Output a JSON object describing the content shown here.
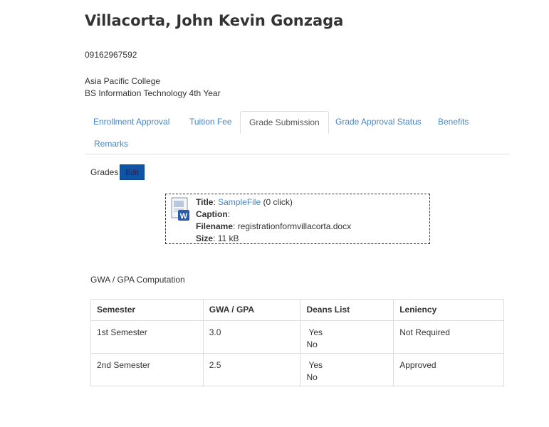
{
  "profile": {
    "name": "Villacorta, John Kevin Gonzaga",
    "phone": "09162967592",
    "school": "Asia Pacific College",
    "program": "BS Information Technology 4th Year"
  },
  "tabs": [
    {
      "label": "Enrollment Approval",
      "active": false
    },
    {
      "label": "Tuition Fee",
      "active": false
    },
    {
      "label": "Grade Submission",
      "active": true
    },
    {
      "label": "Grade Approval Status",
      "active": false
    },
    {
      "label": "Benefits",
      "active": false
    },
    {
      "label": "Remarks",
      "active": false
    }
  ],
  "grades": {
    "label": "Grades",
    "edit_label": "Edit"
  },
  "file": {
    "icon": "word-document-icon",
    "title_key": "Title",
    "title_value": "SampleFile",
    "clicks": "(0 click)",
    "caption_key": "Caption",
    "caption_value": "",
    "filename_key": "Filename",
    "filename_value": "registrationformvillacorta.docx",
    "size_key": "Size",
    "size_value": "11 kB"
  },
  "gwa": {
    "title": "GWA / GPA Computation",
    "headers": [
      "Semester",
      "GWA / GPA",
      "Deans List",
      "Leniency"
    ],
    "rows": [
      {
        "semester": "1st Semester",
        "gwa": "3.0",
        "deans_yes": "Yes",
        "deans_no": "No",
        "leniency": "Not Required"
      },
      {
        "semester": "2nd Semester",
        "gwa": "2.5",
        "deans_yes": "Yes",
        "deans_no": "No",
        "leniency": "Approved"
      }
    ]
  },
  "colors": {
    "link": "#4a86c5",
    "edit_button": "#0e55a6",
    "border": "#dddddd"
  }
}
